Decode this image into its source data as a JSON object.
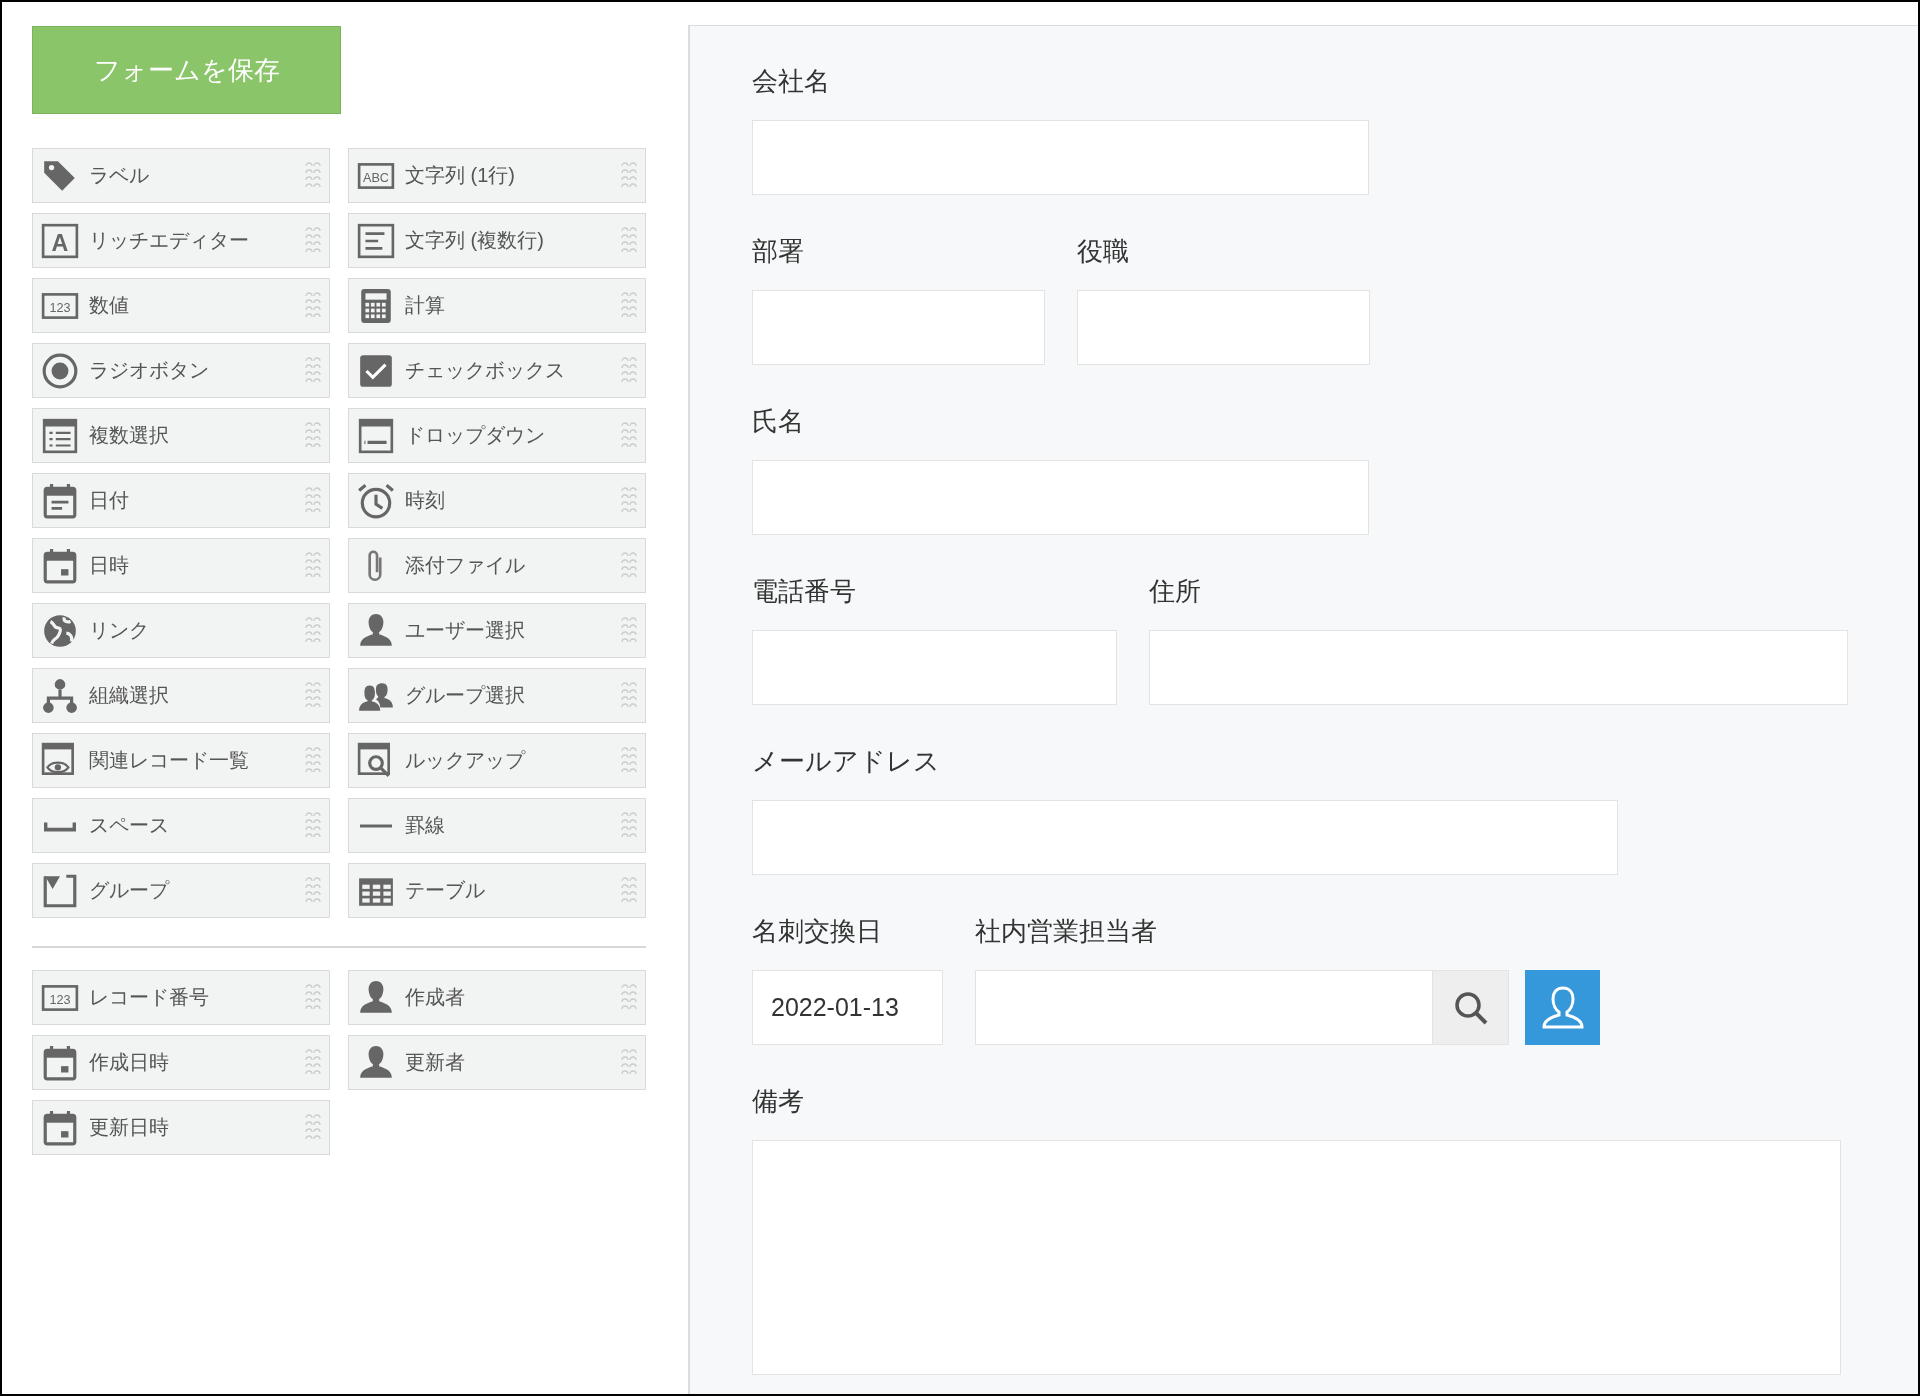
{
  "save_button": {
    "label": "フォームを保存"
  },
  "palette": {
    "items": [
      {
        "label": "ラベル",
        "kind": "tag"
      },
      {
        "label": "文字列 (1行)",
        "kind": "abc",
        "icon_text": "ABC"
      },
      {
        "label": "リッチエディター",
        "kind": "letter",
        "icon_text": "A"
      },
      {
        "label": "文字列 (複数行)",
        "kind": "lines"
      },
      {
        "label": "数値",
        "kind": "number",
        "icon_text": "123"
      },
      {
        "label": "計算",
        "kind": "calc"
      },
      {
        "label": "ラジオボタン",
        "kind": "radio"
      },
      {
        "label": "チェックボックス",
        "kind": "checkbox"
      },
      {
        "label": "複数選択",
        "kind": "multi"
      },
      {
        "label": "ドロップダウン",
        "kind": "dropdown"
      },
      {
        "label": "日付",
        "kind": "date"
      },
      {
        "label": "時刻",
        "kind": "clock"
      },
      {
        "label": "日時",
        "kind": "datetime"
      },
      {
        "label": "添付ファイル",
        "kind": "clip"
      },
      {
        "label": "リンク",
        "kind": "globe"
      },
      {
        "label": "ユーザー選択",
        "kind": "user"
      },
      {
        "label": "組織選択",
        "kind": "org"
      },
      {
        "label": "グループ選択",
        "kind": "users"
      },
      {
        "label": "関連レコード一覧",
        "kind": "related"
      },
      {
        "label": "ルックアップ",
        "kind": "lookup"
      },
      {
        "label": "スペース",
        "kind": "space"
      },
      {
        "label": "罫線",
        "kind": "line"
      },
      {
        "label": "グループ",
        "kind": "group"
      },
      {
        "label": "テーブル",
        "kind": "table"
      }
    ],
    "system_items": [
      {
        "label": "レコード番号",
        "kind": "number",
        "icon_text": "123"
      },
      {
        "label": "作成者",
        "kind": "user"
      },
      {
        "label": "作成日時",
        "kind": "datetime"
      },
      {
        "label": "更新者",
        "kind": "user"
      },
      {
        "label": "更新日時",
        "kind": "datetime"
      }
    ]
  },
  "form": {
    "rows": [
      {
        "fields": [
          {
            "label": "会社名",
            "kind": "text"
          }
        ]
      },
      {
        "fields": [
          {
            "label": "部署",
            "kind": "text"
          },
          {
            "label": "役職",
            "kind": "text"
          }
        ]
      },
      {
        "fields": [
          {
            "label": "氏名",
            "kind": "text"
          }
        ]
      },
      {
        "fields": [
          {
            "label": "電話番号",
            "kind": "text"
          },
          {
            "label": "住所",
            "kind": "text"
          }
        ]
      },
      {
        "fields": [
          {
            "label": "メールアドレス",
            "kind": "text"
          }
        ]
      },
      {
        "fields": [
          {
            "label": "名刺交換日",
            "kind": "date",
            "value": "2022-01-13"
          },
          {
            "label": "社内営業担当者",
            "kind": "user"
          }
        ]
      },
      {
        "fields": [
          {
            "label": "備考",
            "kind": "textarea"
          }
        ]
      }
    ]
  }
}
